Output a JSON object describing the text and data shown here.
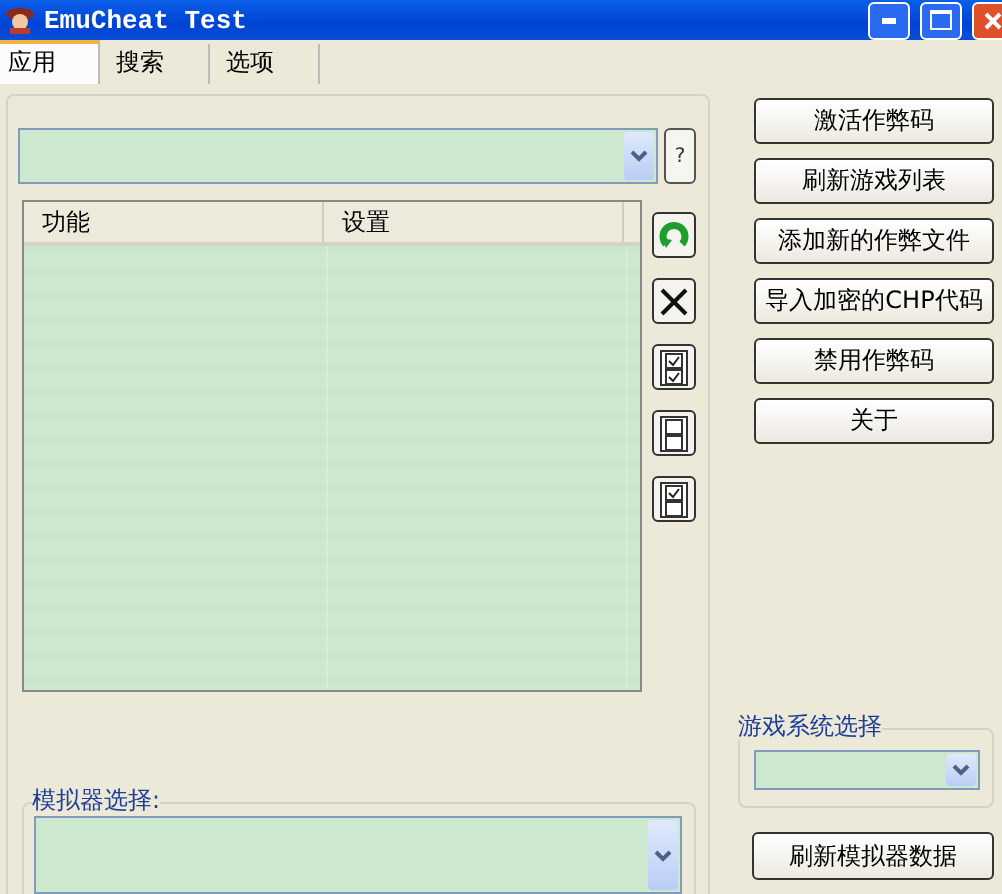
{
  "window": {
    "title": "EmuCheat Test"
  },
  "tabs": [
    {
      "label": "应用",
      "selected": true
    },
    {
      "label": "搜索",
      "selected": false
    },
    {
      "label": "选项",
      "selected": false
    }
  ],
  "help_button": "?",
  "cheat_list": {
    "columns": [
      "功能",
      "设置"
    ]
  },
  "action_buttons": [
    "激活作弊码",
    "刷新游戏列表",
    "添加新的作弊文件",
    "导入加密的CHP代码",
    "禁用作弊码",
    "关于"
  ],
  "game_system": {
    "label": "游戏系统选择"
  },
  "emulator": {
    "label": "模拟器选择:"
  },
  "refresh_emulator_button": "刷新模拟器数据"
}
